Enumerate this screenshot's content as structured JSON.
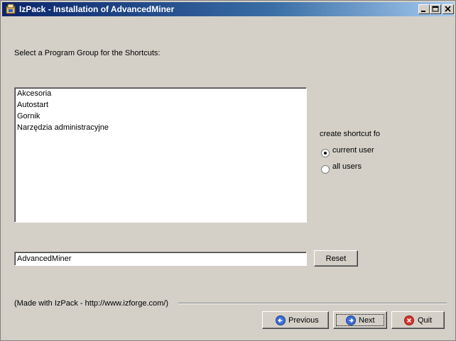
{
  "window": {
    "title": "IzPack - Installation of AdvancedMiner"
  },
  "panel": {
    "heading": "Select a Program Group for the Shortcuts:",
    "groups": [
      "Akcesoria",
      "Autostart",
      "Gornik",
      "Narzędzia administracyjne"
    ],
    "create_shortcut_label": "create shortcut fo",
    "radio_options": [
      {
        "label": "current user",
        "selected": true
      },
      {
        "label": "all users",
        "selected": false
      }
    ],
    "group_name_value": "AdvancedMiner",
    "reset_label": "Reset"
  },
  "footer": {
    "credit": "(Made with IzPack - http://www.izforge.com/)",
    "previous_label": "Previous",
    "next_label": "Next",
    "quit_label": "Quit"
  },
  "colors": {
    "title_gradient_start": "#0a246a",
    "title_gradient_end": "#a6caf0",
    "window_bg": "#d4d0c8",
    "nav_icon_blue": "#3b6fd4",
    "quit_icon_red": "#d8342b"
  },
  "icons": {
    "app": "izpack-app-icon",
    "previous": "arrow-left-circle-icon",
    "next": "arrow-right-circle-icon",
    "quit": "x-circle-icon"
  }
}
